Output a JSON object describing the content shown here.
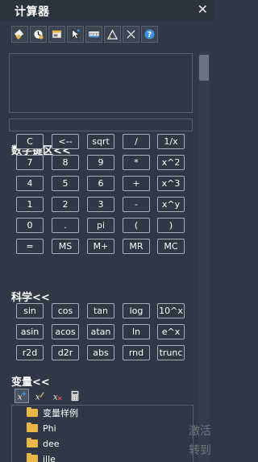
{
  "window": {
    "title": "计算器",
    "close_glyph": "✕"
  },
  "toolbar": {
    "buttons": [
      {
        "name": "eraser-icon"
      },
      {
        "name": "history-clock-icon"
      },
      {
        "name": "window-icon"
      },
      {
        "name": "pointer-select-icon"
      },
      {
        "name": "measure-icon"
      },
      {
        "name": "angle-icon"
      },
      {
        "name": "clear-x-icon"
      },
      {
        "name": "help-icon"
      }
    ]
  },
  "sections": {
    "numeric": "数字键区<<",
    "science": "科学<<",
    "variables": "变量<<"
  },
  "numeric_keys": [
    [
      "C",
      "<--",
      "sqrt",
      "/",
      "1/x"
    ],
    [
      "7",
      "8",
      "9",
      "*",
      "x^2"
    ],
    [
      "4",
      "5",
      "6",
      "+",
      "x^3"
    ],
    [
      "1",
      "2",
      "3",
      "-",
      "x^y"
    ],
    [
      "0",
      ".",
      "pi",
      "(",
      ")"
    ],
    [
      "=",
      "MS",
      "M+",
      "MR",
      "MC"
    ]
  ],
  "science_keys": [
    [
      "sin",
      "cos",
      "tan",
      "log",
      "10^x"
    ],
    [
      "asin",
      "acos",
      "atan",
      "ln",
      "e^x"
    ],
    [
      "r2d",
      "d2r",
      "abs",
      "rnd",
      "trunc"
    ]
  ],
  "variables": {
    "items": [
      "变量样例",
      "Phi",
      "dee",
      "ille"
    ]
  },
  "watermark": {
    "line1": "激活",
    "line2": "转到"
  },
  "colors": {
    "background": "#2f3844",
    "folder": "#e9b748",
    "accent_blue": "#3d8fe0"
  }
}
